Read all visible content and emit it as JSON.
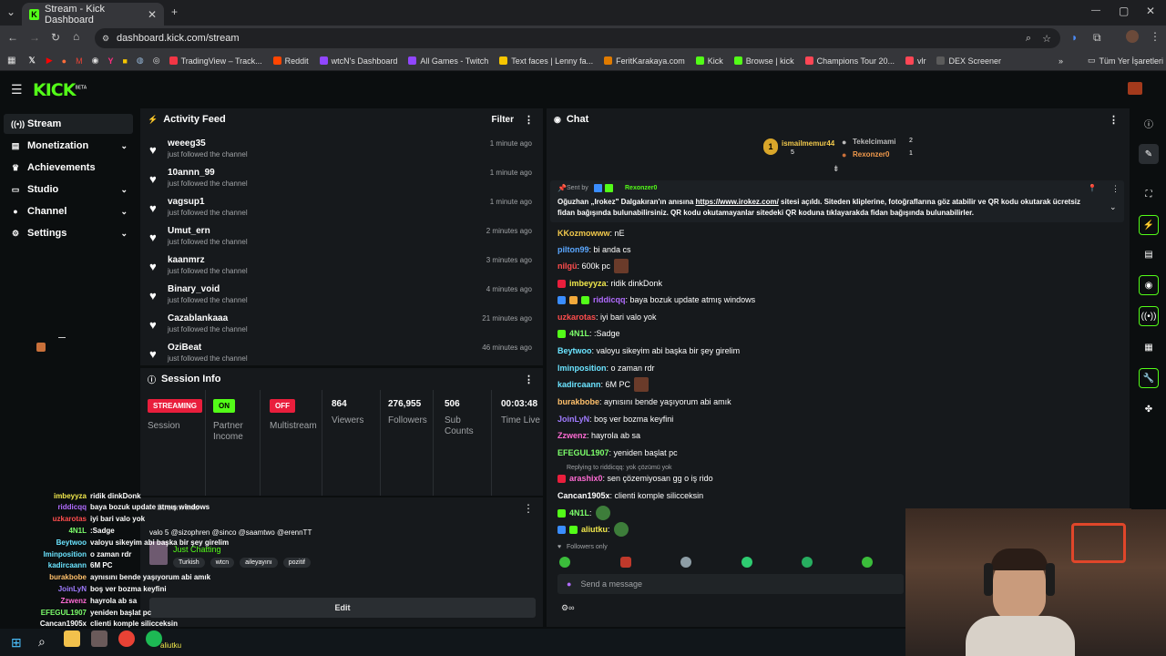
{
  "browser": {
    "tab_title": "Stream - Kick Dashboard",
    "url": "dashboard.kick.com/stream",
    "bookmarks": [
      "TradingView – Track...",
      "Reddit",
      "wtcN's Dashboard",
      "All Games - Twitch",
      "Text faces | Lenny fa...",
      "FeritKarakaya.com",
      "Kick",
      "Browse | kick",
      "Champions Tour 20...",
      "vlr",
      "DEX Screener"
    ],
    "all_bookmarks": "Tüm Yer İşaretleri",
    "bookmark_colors": [
      "#f23645",
      "#ff4500",
      "#9146ff",
      "#9146ff",
      "#f7c600",
      "#e07b00",
      "#53fc18",
      "#53fc18",
      "#ff4655",
      "#ff4655",
      "#5b5b5b"
    ]
  },
  "kick": {
    "logo": "KICK",
    "logo_sup": "BETA"
  },
  "sidebar": {
    "items": [
      {
        "label": "Stream",
        "icon": "broadcast-icon",
        "glyph": "((•))"
      },
      {
        "label": "Monetization",
        "icon": "bank-icon",
        "glyph": "▤"
      },
      {
        "label": "Achievements",
        "icon": "trophy-icon",
        "glyph": "♛"
      },
      {
        "label": "Studio",
        "icon": "monitor-icon",
        "glyph": "▭"
      },
      {
        "label": "Channel",
        "icon": "user-icon",
        "glyph": "●"
      },
      {
        "label": "Settings",
        "icon": "gear-icon",
        "glyph": "⚙"
      }
    ]
  },
  "activity": {
    "title": "Activity Feed",
    "filter": "Filter",
    "items": [
      {
        "user": "weeeg35",
        "sub": "just followed the channel",
        "time": "1 minute ago"
      },
      {
        "user": "10annn_99",
        "sub": "just followed the channel",
        "time": "1 minute ago"
      },
      {
        "user": "vagsup1",
        "sub": "just followed the channel",
        "time": "1 minute ago"
      },
      {
        "user": "Umut_ern",
        "sub": "just followed the channel",
        "time": "2 minutes ago"
      },
      {
        "user": "kaanmrz",
        "sub": "just followed the channel",
        "time": "3 minutes ago"
      },
      {
        "user": "Binary_void",
        "sub": "just followed the channel",
        "time": "4 minutes ago"
      },
      {
        "user": "Cazablankaaa",
        "sub": "just followed the channel",
        "time": "21 minutes ago"
      },
      {
        "user": "OziBeat",
        "sub": "just followed the channel",
        "time": "46 minutes ago"
      }
    ]
  },
  "session": {
    "title": "Session Info",
    "session_badge": "STREAMING",
    "session_label": "Session",
    "partner_badge": "ON",
    "partner_label_1": "Partner",
    "partner_label_2": "Income",
    "multistream_badge": "OFF",
    "multistream_label": "Multistream",
    "viewers": "864",
    "viewers_label": "Viewers",
    "followers": "276,955",
    "followers_label": "Followers",
    "subs": "506",
    "subs_label_1": "Sub",
    "subs_label_2": "Counts",
    "time": "00:03:48",
    "time_label": "Time Live"
  },
  "stream_info": {
    "header": "Stream Info",
    "title": "valo 5 @sizophren @sinco @saamtwo @erennTT",
    "category": "Just Chatting",
    "tags": [
      "Turkish",
      "wtcn",
      "aileyayını",
      "pozitif"
    ],
    "edit": "Edit"
  },
  "chat": {
    "title": "Chat",
    "leaderboard": {
      "rank1": {
        "name": "ismailmemur44",
        "value": "5"
      },
      "rank2": {
        "name": "Tekelcimami",
        "value": "2"
      },
      "rank3": {
        "name": "Rexonzer0",
        "value": "1"
      }
    },
    "pinned": {
      "sent_by": "Sent by",
      "sender": "Rexonzer0",
      "text_a": "Oğuzhan „Irokez\" Dalgakıran'ın anısına ",
      "link": "https://www.irokez.com/",
      "text_b": " sitesi açıldı. Siteden kliplerine, fotoğraflarına göz atabilir ve QR kodu okutarak ücretsiz fidan bağışında bulunabilirsiniz. QR kodu okutamayanlar sitedeki QR koduna tıklayarakda fidan bağışında bulunabilirler."
    },
    "messages": [
      {
        "user": "KKozmowww",
        "color": "#f2c94c",
        "text": ": nE"
      },
      {
        "user": "pilton99",
        "color": "#5ba7ff",
        "text": ": bi anda cs"
      },
      {
        "user": "nilgü",
        "color": "#ff4d4d",
        "text": ": 600k pc"
      },
      {
        "user": "imbeyyza",
        "color": "#f2e94c",
        "text": ": ridik dinkDonk"
      },
      {
        "user": "riddicqq",
        "color": "#b26cff",
        "text": ": baya bozuk update atmış windows"
      },
      {
        "user": "uzkarotas",
        "color": "#ff4d4d",
        "text": ": iyi bari valo yok"
      },
      {
        "user": "4N1L",
        "color": "#7dff6b",
        "text": ": :Sadge"
      },
      {
        "user": "Beytwoo",
        "color": "#6be4ff",
        "text": ": valoyu sikeyim abi başka bir şey girelim"
      },
      {
        "user": "lminposition",
        "color": "#6be4ff",
        "text": ": o zaman rdr"
      },
      {
        "user": "kadircaann",
        "color": "#6be4ff",
        "text": ": 6M PC"
      },
      {
        "user": "burakbobe",
        "color": "#ffc06b",
        "text": ": aynısını bende yaşıyorum abi amık"
      },
      {
        "user": "JoinLyN",
        "color": "#a07bff",
        "text": ": boş ver bozma keyfini"
      },
      {
        "user": "Zzwenz",
        "color": "#ff6bd4",
        "text": ": hayrola ab sa"
      },
      {
        "user": "EFEGUL1907",
        "color": "#7dff6b",
        "text": ": yeniden başlat pc"
      },
      {
        "user": "arashix0",
        "color": "#ff6bd4",
        "text": ": sen çözemiyosan gg o iş rido"
      },
      {
        "user": "Cancan1905x",
        "color": "#ffffff",
        "text": ": clienti komple silicceksin"
      },
      {
        "user": "4N1L",
        "color": "#7dff6b",
        "text": ":"
      },
      {
        "user": "aliutku",
        "color": "#f2e94c",
        "text": ":"
      }
    ],
    "reply_note": "Replying to riddicqq: yok çözümü yok",
    "followers_only": "Followers only",
    "placeholder": "Send a message"
  },
  "overlay_chat": [
    {
      "user": "imbeyyza",
      "color": "#f2e94c",
      "text": "ridik dinkDonk"
    },
    {
      "user": "riddicqq",
      "color": "#b26cff",
      "text": "baya bozuk update atmış windows"
    },
    {
      "user": "uzkarotas",
      "color": "#ff4d4d",
      "text": "iyi bari valo yok"
    },
    {
      "user": "4N1L",
      "color": "#7dff6b",
      "text": ":Sadge"
    },
    {
      "user": "Beytwoo",
      "color": "#6be4ff",
      "text": "valoyu sikeyim abi başka bir şey girelim"
    },
    {
      "user": "lminposition",
      "color": "#6be4ff",
      "text": "o zaman rdr"
    },
    {
      "user": "kadircaann",
      "color": "#6be4ff",
      "text": "6M PC"
    },
    {
      "user": "burakbobe",
      "color": "#ffc06b",
      "text": "aynısını bende yaşıyorum abi amık"
    },
    {
      "user": "JoinLyN",
      "color": "#a07bff",
      "text": "boş ver bozma keyfini"
    },
    {
      "user": "Zzwenz",
      "color": "#ff6bd4",
      "text": "hayrola ab sa"
    },
    {
      "user": "EFEGUL1907",
      "color": "#7dff6b",
      "text": "yeniden başlat pc"
    },
    {
      "user": "Cancan1905x",
      "color": "#ffffff",
      "text": "clienti komple silicceksin"
    }
  ],
  "taskbar": {
    "tray_text": "aliutku"
  },
  "colors": {
    "accent": "#53fc18",
    "streaming": "#e91e3c",
    "off": "#e91e3c"
  }
}
